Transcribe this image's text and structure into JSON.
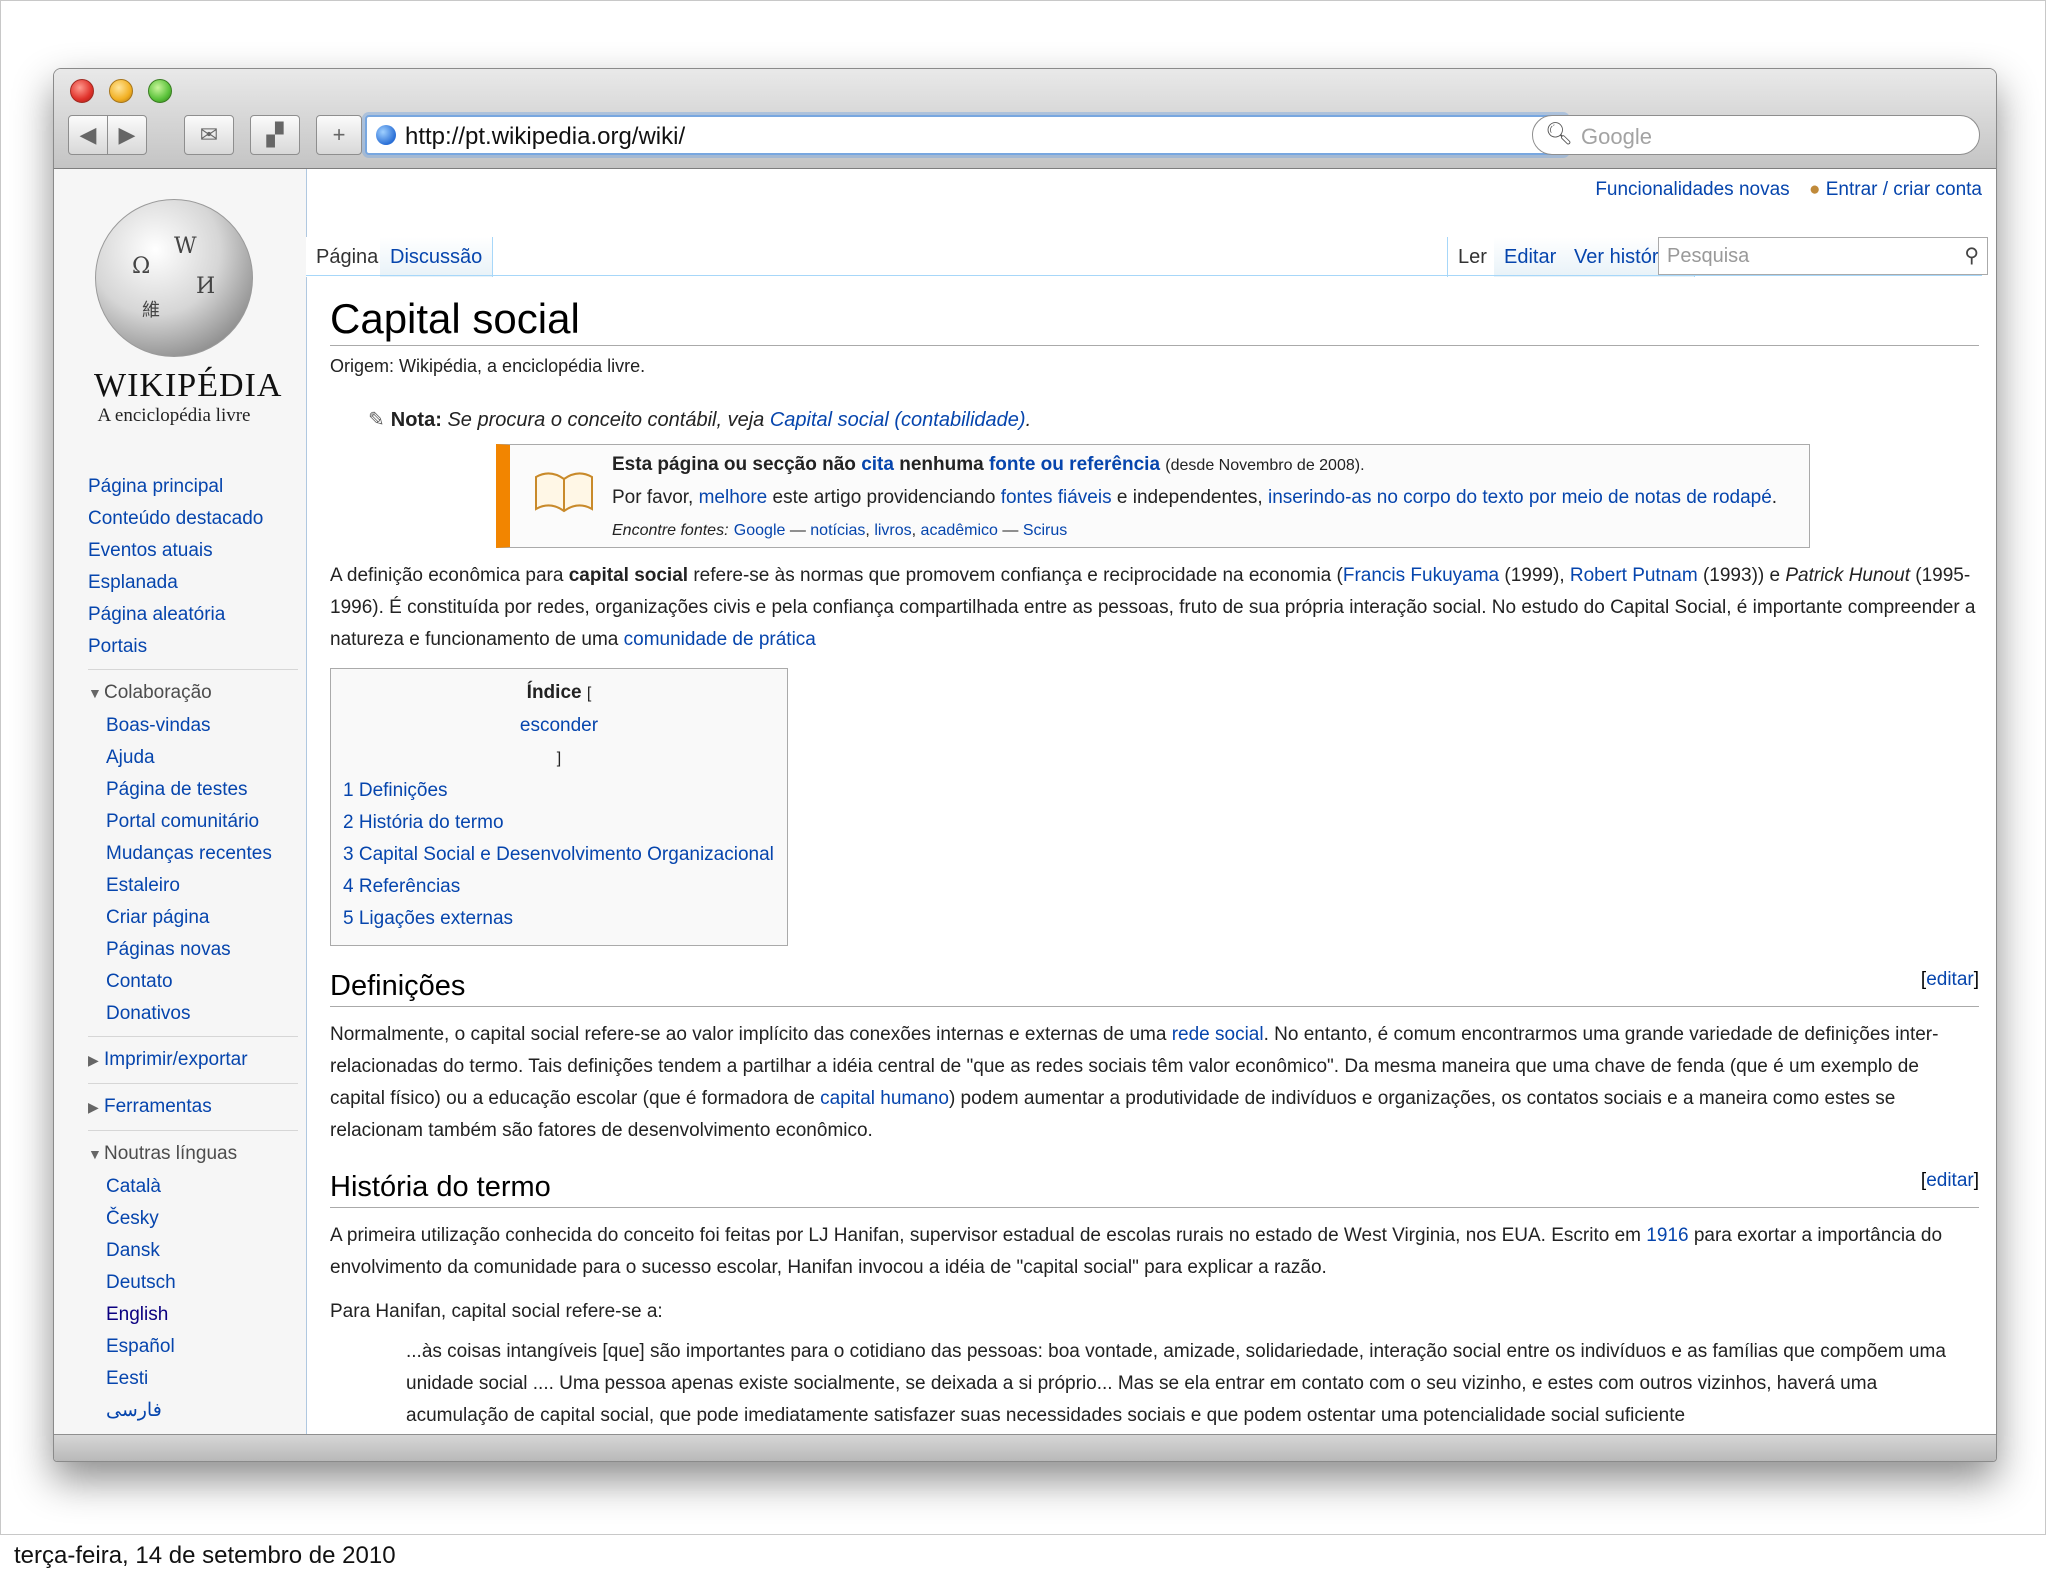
{
  "browser": {
    "url": "http://pt.wikipedia.org/wiki/",
    "search_placeholder": "Google"
  },
  "personal": {
    "new_features": "Funcionalidades novas",
    "login": "Entrar / criar conta"
  },
  "logo": {
    "wordmark": "WIKIPÉDIA",
    "tagline": "A enciclopédia livre"
  },
  "nav": {
    "main": [
      "Página principal",
      "Conteúdo destacado",
      "Eventos atuais",
      "Esplanada",
      "Página aleatória",
      "Portais"
    ],
    "colab_header": "Colaboração",
    "colab": [
      "Boas-vindas",
      "Ajuda",
      "Página de testes",
      "Portal comunitário",
      "Mudanças recentes",
      "Estaleiro",
      "Criar página",
      "Páginas novas",
      "Contato",
      "Donativos"
    ],
    "print_header": "Imprimir/exportar",
    "tools_header": "Ferramentas",
    "lang_header": "Noutras línguas",
    "langs": [
      "Català",
      "Česky",
      "Dansk",
      "Deutsch",
      "English",
      "Español",
      "Eesti",
      "فارسی"
    ]
  },
  "tabs": {
    "page": "Página",
    "talk": "Discussão",
    "read": "Ler",
    "edit": "Editar",
    "history": "Ver histórico",
    "search_placeholder": "Pesquisa"
  },
  "article": {
    "title": "Capital social",
    "site_sub": "Origem: Wikipédia, a enciclopédia livre.",
    "note_label": "Nota:",
    "note_text": "Se procura o conceito contábil, veja",
    "note_link": "Capital social (contabilidade)",
    "ambox": {
      "l1a": "Esta página ou secção não",
      "l1b": "cita",
      "l1c": "nenhuma",
      "l1d": "fonte ou referência",
      "l1e": "(desde Novembro de 2008).",
      "l2a": "Por favor,",
      "l2b": "melhore",
      "l2c": "este artigo providenciando",
      "l2d": "fontes fiáveis",
      "l2e": "e independentes,",
      "l2f": "inserindo-as no corpo do texto por meio de notas de rodapé",
      "l3a": "Encontre fontes:",
      "src1": "Google",
      "src2": "notícias",
      "src3": "livros",
      "src4": "acadêmico",
      "src5": "Scirus"
    },
    "intro": {
      "a": "A definição econômica para",
      "b": "capital social",
      "c": "refere-se às normas que promovem confiança e reciprocidade na economia (",
      "d": "Francis Fukuyama",
      "e": "(1999),",
      "f": "Robert Putnam",
      "g": "(1993)) e",
      "h": "Patrick Hunout",
      "i": "(1995-1996). É constituída por redes, organizações civis e pela confiança compartilhada entre as pessoas, fruto de sua própria interação social. No estudo do Capital Social, é importante compreender a natureza e funcionamento de uma",
      "j": "comunidade de prática"
    },
    "toc": {
      "title": "Índice",
      "hide": "esconder",
      "items": [
        "1 Definições",
        "2 História do termo",
        "3 Capital Social e Desenvolvimento Organizacional",
        "4 Referências",
        "5 Ligações externas"
      ]
    },
    "edit_label": "editar",
    "s1": {
      "heading": "Definições",
      "a": "Normalmente, o capital social refere-se ao valor implícito das conexões internas e externas de uma",
      "b": "rede social",
      "c": ". No entanto, é comum encontrarmos uma grande variedade de definições inter-relacionadas do termo. Tais definições tendem a partilhar a idéia central de \"que as redes sociais têm valor econômico\". Da mesma maneira que uma chave de fenda (que é um exemplo de capital físico) ou a educação escolar (que é formadora de",
      "d": "capital humano",
      "e": ") podem aumentar a produtividade de indivíduos e organizações, os contatos sociais e a maneira como estes se relacionam também são fatores de desenvolvimento econômico."
    },
    "s2": {
      "heading": "História do termo",
      "a": "A primeira utilização conhecida do conceito foi feitas por LJ Hanifan, supervisor estadual de escolas rurais no estado de West Virginia, nos EUA. Escrito em",
      "b": "1916",
      "c": "para exortar a importância do envolvimento da comunidade para o sucesso escolar, Hanifan invocou a idéia de \"capital social\" para explicar a razão.",
      "p2": "Para Hanifan, capital social refere-se a:",
      "quote": "...às coisas intangíveis [que] são importantes para o cotidiano das pessoas: boa vontade, amizade, solidariedade, interação social entre os indivíduos e as famílias que compõem uma unidade social .... Uma pessoa apenas existe socialmente, se deixada a si próprio... Mas se ela entrar em contato com o seu vizinho, e estes com outros vizinhos, haverá uma acumulação de capital social, que pode imediatamente satisfazer suas necessidades sociais e que podem ostentar uma potencialidade social suficiente"
    }
  },
  "caption": "terça-feira, 14 de setembro de 2010",
  "colors": {
    "link": "#0645ad",
    "ambox_accent": "#f28500",
    "tab_border": "#a7d7f9"
  }
}
